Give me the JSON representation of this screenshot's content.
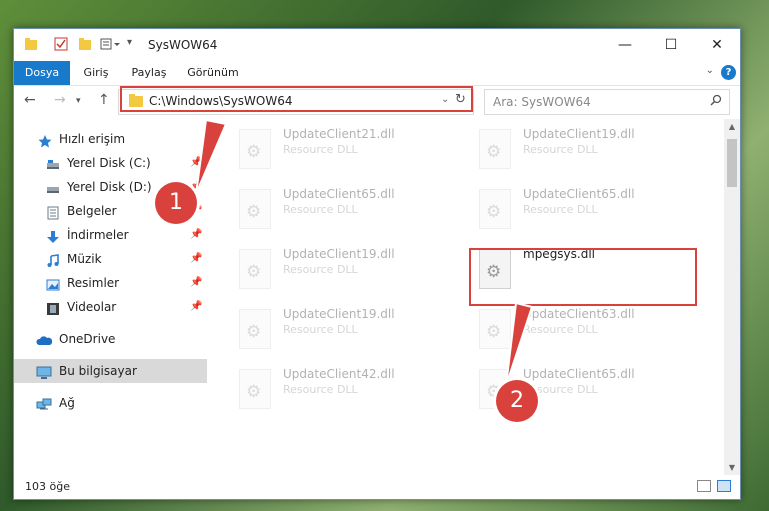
{
  "window": {
    "title": "SysWOW64"
  },
  "ribbon": {
    "tabs": [
      "Dosya",
      "Giriş",
      "Paylaş",
      "Görünüm"
    ]
  },
  "address": {
    "path": "C:\\Windows\\SysWOW64"
  },
  "search": {
    "placeholder": "Ara: SysWOW64"
  },
  "sidebar": {
    "items": [
      {
        "label": "Hızlı erişim",
        "icon": "star-icon"
      },
      {
        "label": "Yerel Disk (C:)",
        "icon": "drive-icon",
        "pinned": true
      },
      {
        "label": "Yerel Disk (D:)",
        "icon": "drive-icon",
        "pinned": true
      },
      {
        "label": "Belgeler",
        "icon": "documents-icon",
        "pinned": true
      },
      {
        "label": "İndirmeler",
        "icon": "downloads-icon",
        "pinned": true
      },
      {
        "label": "Müzik",
        "icon": "music-icon",
        "pinned": true
      },
      {
        "label": "Resimler",
        "icon": "pictures-icon",
        "pinned": true
      },
      {
        "label": "Videolar",
        "icon": "videos-icon",
        "pinned": true
      },
      {
        "label": "OneDrive",
        "icon": "onedrive-icon"
      },
      {
        "label": "Bu bilgisayar",
        "icon": "computer-icon",
        "selected": true
      },
      {
        "label": "Ağ",
        "icon": "network-icon"
      }
    ]
  },
  "files": [
    {
      "name": "UpdateClient21.dll",
      "type": "Resource DLL"
    },
    {
      "name": "UpdateClient19.dll",
      "type": "Resource DLL"
    },
    {
      "name": "UpdateClient65.dll",
      "type": "Resource DLL"
    },
    {
      "name": "UpdateClient65.dll",
      "type": "Resource DLL"
    },
    {
      "name": "UpdateClient19.dll",
      "type": "Resource DLL"
    },
    {
      "name": "mpegsys.dll",
      "type": ""
    },
    {
      "name": "UpdateClient19.dll",
      "type": "Resource DLL"
    },
    {
      "name": "UpdateClient63.dll",
      "type": "Resource DLL"
    },
    {
      "name": "UpdateClient42.dll",
      "type": "Resource DLL"
    },
    {
      "name": "UpdateClient65.dll",
      "type": "Resource DLL"
    }
  ],
  "status": {
    "item_count": "103 öğe"
  },
  "annotations": {
    "step1": "1",
    "step2": "2",
    "color": "#d9413d"
  },
  "colors": {
    "accent": "#1979ca",
    "highlight": "#d9413d"
  }
}
